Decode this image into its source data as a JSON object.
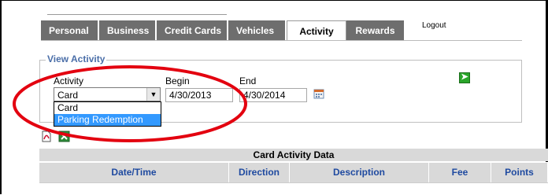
{
  "tabs": {
    "items": [
      {
        "label": "Personal"
      },
      {
        "label": "Business"
      },
      {
        "label": "Credit Cards"
      },
      {
        "label": "Vehicles"
      },
      {
        "label": "Activity",
        "active": true
      },
      {
        "label": "Rewards"
      }
    ],
    "logout": "Logout"
  },
  "filter": {
    "legend": "View Activity",
    "activity_label": "Activity",
    "activity_value": "Card",
    "activity_options": [
      "Card",
      "Parking Redemption"
    ],
    "highlighted_option": "Parking Redemption",
    "begin_label": "Begin",
    "begin_value": "4/30/2013",
    "end_label": "End",
    "end_value": "4/30/2014"
  },
  "table": {
    "title": "Card Activity Data",
    "columns": [
      "Date/Time",
      "Direction",
      "Description",
      "Fee",
      "Points"
    ]
  },
  "icons": {
    "export_pdf": "pdf-icon",
    "export_excel": "excel-icon",
    "calendar": "calendar-icon",
    "go": "go-arrow-icon"
  },
  "colors": {
    "tab_bg": "#6e6e6e",
    "legend_text": "#4a6ea8",
    "header_text": "#1f4aa0",
    "selection": "#3399ff",
    "annotation": "#e3000f"
  }
}
